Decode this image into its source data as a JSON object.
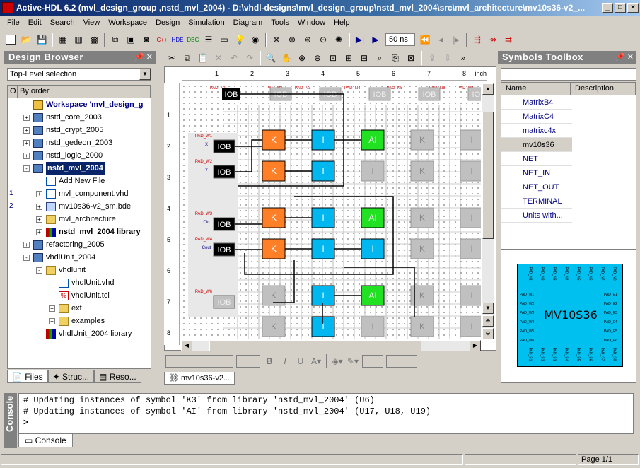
{
  "window": {
    "title": "Active-HDL 6.2 (mvl_design_group ,nstd_mvl_2004) - D:\\vhdl-designs\\mvl_design_group\\nstd_mvl_2004\\src\\mvl_architecture\\mv10s36-v2_...",
    "controls": [
      "_",
      "□",
      "×"
    ]
  },
  "menu": [
    "File",
    "Edit",
    "Search",
    "View",
    "Workspace",
    "Design",
    "Simulation",
    "Diagram",
    "Tools",
    "Window",
    "Help"
  ],
  "toolbar": {
    "sim_time": "50 ns"
  },
  "design_browser": {
    "title": "Design Browser",
    "selector": "Top-Level selection",
    "columns": [
      "O",
      "By order"
    ],
    "tree": [
      {
        "label": "Workspace 'mvl_design_g",
        "indent": 0,
        "icon": "workspace-icon",
        "bold": true,
        "color": "#000080"
      },
      {
        "label": "nstd_core_2003",
        "indent": 0,
        "icon": "library-icon",
        "expand": "+"
      },
      {
        "label": "nstd_crypt_2005",
        "indent": 0,
        "icon": "library-icon",
        "expand": "+"
      },
      {
        "label": "nstd_gedeon_2003",
        "indent": 0,
        "icon": "library-icon",
        "expand": "+"
      },
      {
        "label": "nstd_logic_2000",
        "indent": 0,
        "icon": "library-icon",
        "expand": "+"
      },
      {
        "label": "nstd_mvl_2004",
        "indent": 0,
        "icon": "library-icon",
        "expand": "-",
        "bold": true,
        "selected": true
      },
      {
        "label": "Add New File",
        "indent": 1,
        "icon": "add-file-icon"
      },
      {
        "label": "mvl_component.vhd",
        "indent": 1,
        "icon": "vhdl-file-icon",
        "expand": "+",
        "num": "1"
      },
      {
        "label": "mv10s36-v2_sm.bde",
        "indent": 1,
        "icon": "bde-file-icon",
        "expand": "+",
        "num": "2"
      },
      {
        "label": "mvl_architecture",
        "indent": 1,
        "icon": "folder-icon",
        "expand": "+"
      },
      {
        "label": "nstd_mvl_2004 library",
        "indent": 1,
        "icon": "books-icon",
        "expand": "+",
        "bold": true
      },
      {
        "label": "refactoring_2005",
        "indent": 0,
        "icon": "library-icon",
        "expand": "+"
      },
      {
        "label": "vhdlUnit_2004",
        "indent": 0,
        "icon": "library-icon",
        "expand": "-"
      },
      {
        "label": "vhdlunit",
        "indent": 1,
        "icon": "folder-icon",
        "expand": "-"
      },
      {
        "label": "vhdlUnit.vhd",
        "indent": 2,
        "icon": "vhdl-file-icon"
      },
      {
        "label": "vhdlUnit.tcl",
        "indent": 2,
        "icon": "tcl-file-icon"
      },
      {
        "label": "ext",
        "indent": 2,
        "icon": "folder-icon",
        "expand": "+"
      },
      {
        "label": "examples",
        "indent": 2,
        "icon": "folder-icon",
        "expand": "+"
      },
      {
        "label": "vhdlUnit_2004 library",
        "indent": 1,
        "icon": "books-icon"
      }
    ],
    "tabs": [
      "Files",
      "Struc...",
      "Reso..."
    ]
  },
  "schematic": {
    "ruler_numbers": [
      "1",
      "2",
      "3",
      "4",
      "5",
      "6",
      "7",
      "8"
    ],
    "ruler_unit": "inch",
    "left_ruler_numbers": [
      "1",
      "2",
      "3",
      "4",
      "5",
      "6",
      "7",
      "8"
    ],
    "pad_labels_top": [
      "PAD_N1",
      "PAD_N2",
      "PAD_N3",
      "PAD_N4",
      "PAD_N5",
      "PAD_N6",
      "PAD_N8"
    ],
    "pad_labels_left": [
      "PAD_W1",
      "PAD_W2",
      "PAD_W3",
      "PAD_W4",
      "PAD_W6"
    ],
    "pin_labels_left": [
      "X",
      "Y",
      "Cin",
      "Cout"
    ],
    "tab_label": "mv10s36-v2...",
    "blocks": {
      "iob": "IOB",
      "k": "K",
      "i": "I",
      "ai": "AI"
    }
  },
  "symbols": {
    "title": "Symbols Toolbox",
    "columns": [
      "Name",
      "Description"
    ],
    "rows": [
      "MatrixB4",
      "MatrixC4",
      "matrixc4x",
      "mv10s36",
      "NET",
      "NET_IN",
      "NET_OUT",
      "TERMINAL",
      "Units with..."
    ],
    "selected": "mv10s36",
    "chip_name": "MV10S36",
    "chip_pins_top": [
      "PAD_N1",
      "PAD_N2",
      "PAD_N3",
      "PAD_N4",
      "PAD_N5",
      "PAD_N6",
      "PAD_N7",
      "PAD_N8"
    ],
    "chip_pins_left": [
      "PAD_W1",
      "PAD_W2",
      "PAD_W3",
      "PAD_W4",
      "PAD_W5",
      "PAD_W6"
    ],
    "chip_pins_right": [
      "PAD_E1",
      "PAD_E2",
      "PAD_E3",
      "PAD_E4",
      "PAD_E5",
      "PAD_E6"
    ],
    "chip_pins_bottom": [
      "PAD_S1",
      "PAD_S2",
      "PAD_S3",
      "PAD_S4",
      "PAD_S5",
      "PAD_S6",
      "PAD_S7",
      "PAD_S8"
    ]
  },
  "console": {
    "title": "Console",
    "lines": [
      "# Updating instances of symbol 'K3' from library 'nstd_mvl_2004' (U6)",
      "# Updating instances of symbol 'AI' from library 'nstd_mvl_2004' (U17, U18, U19)"
    ],
    "prompt": ">",
    "tab": "Console"
  },
  "status": {
    "page": "Page 1/1"
  },
  "colors": {
    "k_block": "#ff7f27",
    "i_block": "#00b7ef",
    "ai_block": "#22e022",
    "iob_block": "#000000",
    "disabled": "#c0c0c0"
  }
}
